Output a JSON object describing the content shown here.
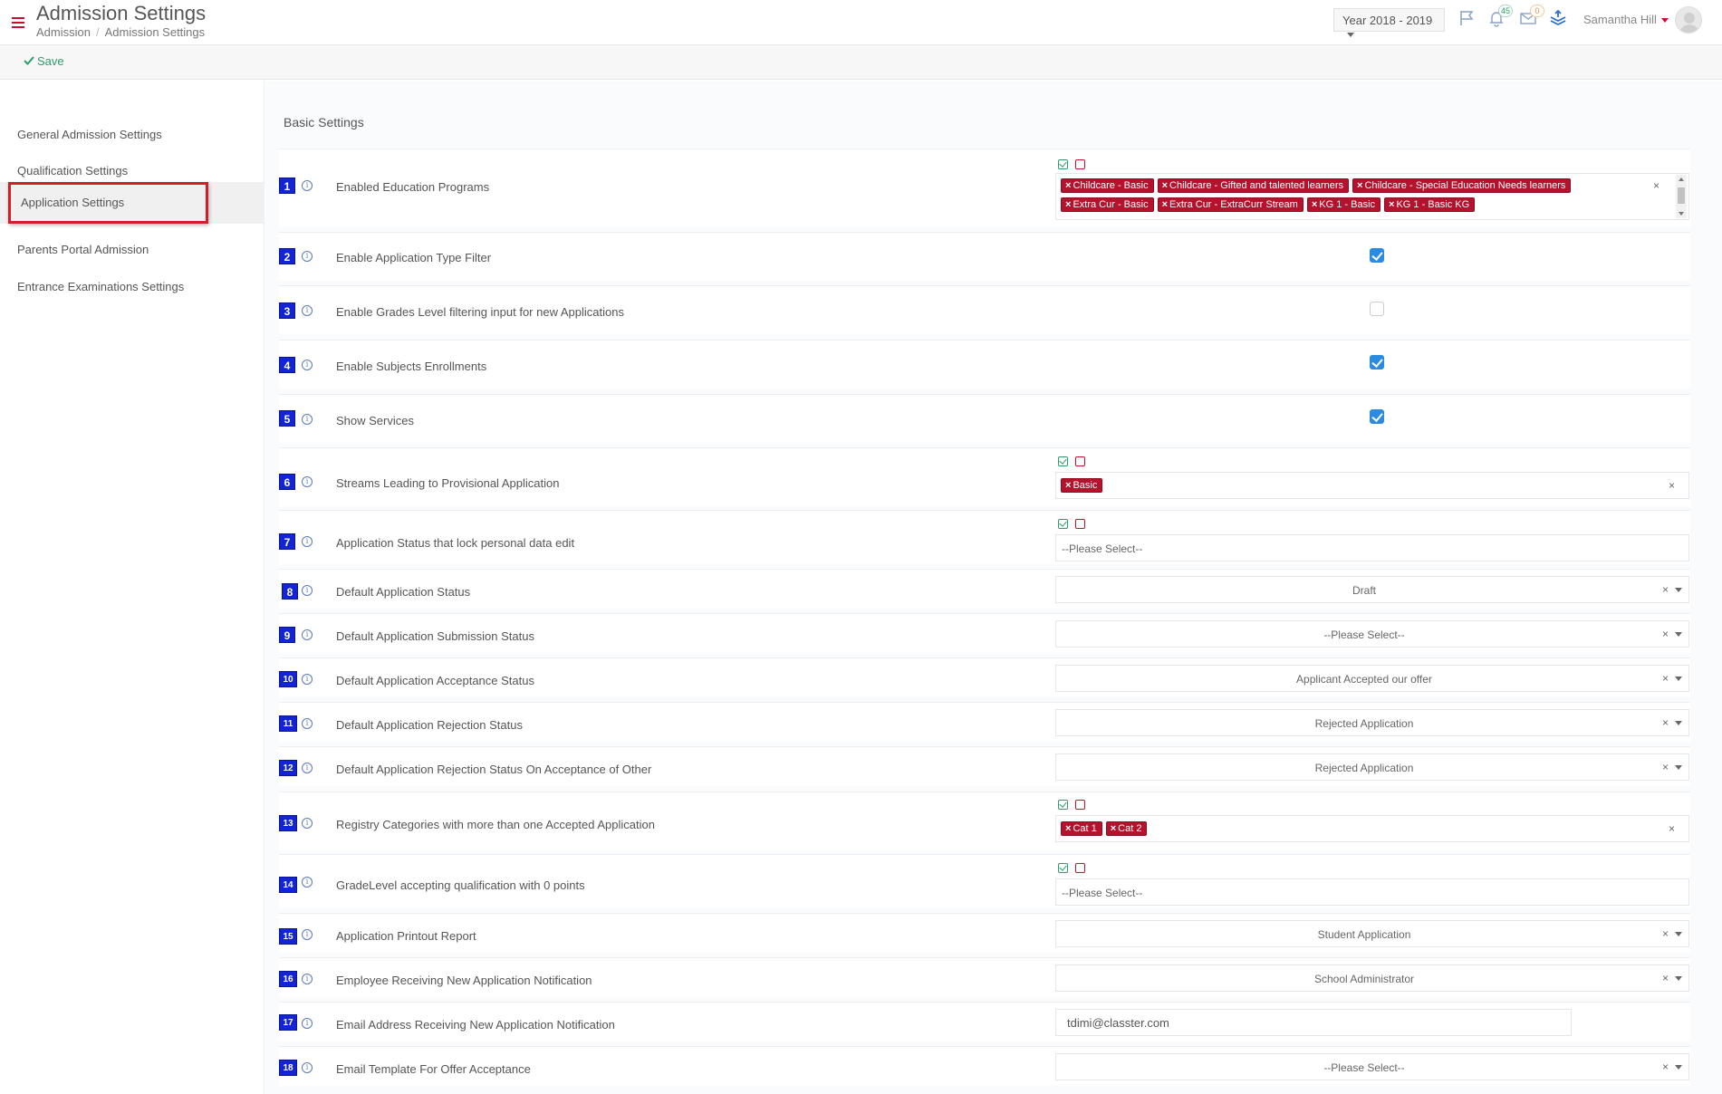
{
  "header": {
    "title": "Admission Settings",
    "breadcrumb": [
      "Admission",
      "Admission Settings"
    ],
    "breadcrumb_sep": "/",
    "year": "Year 2018 - 2019",
    "notifications_count": "45",
    "messages_count": "0",
    "user_name": "Samantha Hill"
  },
  "toolbar": {
    "save_label": "Save"
  },
  "sidebar": {
    "items": [
      {
        "label": "General Admission Settings"
      },
      {
        "label": "Qualification Settings"
      },
      {
        "label": "Application Settings"
      },
      {
        "label": "Parents Portal Admission"
      },
      {
        "label": "Entrance Examinations Settings"
      }
    ],
    "active_index": 2
  },
  "section_title": "Basic Settings",
  "clear_symbol": "×",
  "info_symbol": "i",
  "rows": [
    {
      "num": "1",
      "label": "Enabled Education Programs",
      "type": "multi",
      "tags": [
        "Childcare - Basic",
        "Childcare - Gifted and talented learners",
        "Childcare - Special Education Needs learners",
        "Extra Cur - Basic",
        "Extra Cur - ExtraCurr Stream",
        "KG 1 - Basic",
        "KG 1 - Basic KG"
      ]
    },
    {
      "num": "2",
      "label": "Enable Application Type Filter",
      "type": "checkbox",
      "checked": true
    },
    {
      "num": "3",
      "label": "Enable Grades Level filtering input for new Applications",
      "type": "checkbox",
      "checked": false
    },
    {
      "num": "4",
      "label": "Enable Subjects Enrollments",
      "type": "checkbox",
      "checked": true
    },
    {
      "num": "5",
      "label": "Show Services",
      "type": "checkbox",
      "checked": true
    },
    {
      "num": "6",
      "label": "Streams Leading to Provisional Application",
      "type": "multi",
      "tags": [
        "Basic"
      ]
    },
    {
      "num": "7",
      "label": "Application Status that lock personal data edit",
      "type": "multi-empty",
      "placeholder": "--Please Select--"
    },
    {
      "num": "8",
      "label": "Default Application Status",
      "type": "select",
      "value": "Draft"
    },
    {
      "num": "9",
      "label": "Default Application Submission Status",
      "type": "select",
      "value": "--Please Select--"
    },
    {
      "num": "10",
      "label": "Default Application Acceptance Status",
      "type": "select",
      "value": "Applicant Accepted our offer"
    },
    {
      "num": "11",
      "label": "Default Application Rejection Status",
      "type": "select",
      "value": "Rejected Application"
    },
    {
      "num": "12",
      "label": "Default Application Rejection Status On Acceptance of Other",
      "type": "select",
      "value": "Rejected Application"
    },
    {
      "num": "13",
      "label": "Registry Categories with more than one Accepted Application",
      "type": "multi",
      "tags": [
        "Cat 1",
        "Cat 2"
      ]
    },
    {
      "num": "14",
      "label": "GradeLevel accepting qualification with 0 points",
      "type": "multi-empty",
      "placeholder": "--Please Select--"
    },
    {
      "num": "15",
      "label": "Application Printout Report",
      "type": "select",
      "value": "Student Application"
    },
    {
      "num": "16",
      "label": "Employee Receiving New Application Notification",
      "type": "select",
      "value": "School Administrator"
    },
    {
      "num": "17",
      "label": "Email Address Receiving New Application Notification",
      "type": "text",
      "value": "tdimi@classter.com"
    },
    {
      "num": "18",
      "label": "Email Template For Offer Acceptance",
      "type": "select",
      "value": "--Please Select--"
    }
  ]
}
